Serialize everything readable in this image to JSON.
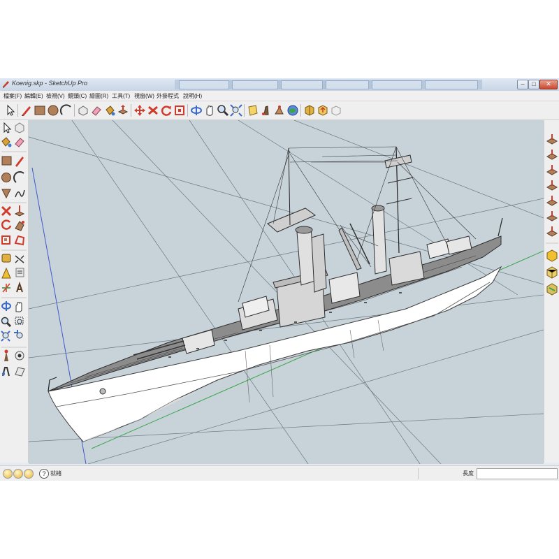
{
  "window": {
    "title": "Koenig.skp - SketchUp Pro",
    "minimize_glyph": "–",
    "maximize_glyph": "□",
    "close_glyph": "✕"
  },
  "menu": {
    "items": [
      "檔案(F)",
      "編輯(E)",
      "檢視(V)",
      "鏡頭(C)",
      "繪圖(R)",
      "工具(T)",
      "視窗(W)",
      "外掛程式",
      "說明(H)"
    ]
  },
  "toolbar": {
    "tools": [
      "select-icon",
      "pencil-icon",
      "rectangle-icon",
      "circle-icon",
      "arc-icon",
      "eraser-icon",
      "paint-bucket-icon",
      "push-pull-icon",
      "make-component-icon",
      "move-icon",
      "rotate-icon",
      "scale-icon",
      "orbit-icon",
      "pan-icon",
      "zoom-icon",
      "zoom-extents-icon",
      "section-plane-icon",
      "walk-icon",
      "look-around-icon",
      "position-camera-icon",
      "get-models-icon",
      "share-model-icon",
      "3d-warehouse-icon"
    ]
  },
  "palettes": {
    "left_tools": [
      "select-icon",
      "make-component-icon",
      "paint-bucket-icon",
      "eraser-icon",
      "rectangle-icon",
      "line-icon",
      "circle-icon",
      "arc-icon",
      "polygon-icon",
      "freehand-icon",
      "move-icon",
      "push-pull-icon",
      "rotate-icon",
      "follow-me-icon",
      "scale-icon",
      "offset-icon",
      "tape-measure-icon",
      "dimension-icon",
      "protractor-icon",
      "text-icon",
      "axes-icon",
      "3d-text-icon",
      "orbit-icon",
      "pan-icon",
      "zoom-icon",
      "zoom-window-icon",
      "zoom-extents-icon",
      "previous-view-icon",
      "position-camera-icon",
      "look-around-icon",
      "walk-icon",
      "section-plane-icon"
    ],
    "right_tools": [
      "iso-view-icon",
      "top-view-icon",
      "front-view-icon",
      "right-view-icon",
      "back-view-icon",
      "left-view-icon",
      "perspective-icon",
      "shaded-icon",
      "textured-icon",
      "monochrome-icon"
    ]
  },
  "statusbar": {
    "help_glyph": "?",
    "status_text": "就緒",
    "measurement_label": "長度",
    "measurement_value": ""
  },
  "colors": {
    "viewport_bg": "#c7d2d9",
    "hull": "#ffffff",
    "outline": "#3a3a3a",
    "deck": "#8a8a8a",
    "axis_red": "#d04545",
    "axis_green": "#3aa54a",
    "axis_blue": "#4058c8"
  }
}
